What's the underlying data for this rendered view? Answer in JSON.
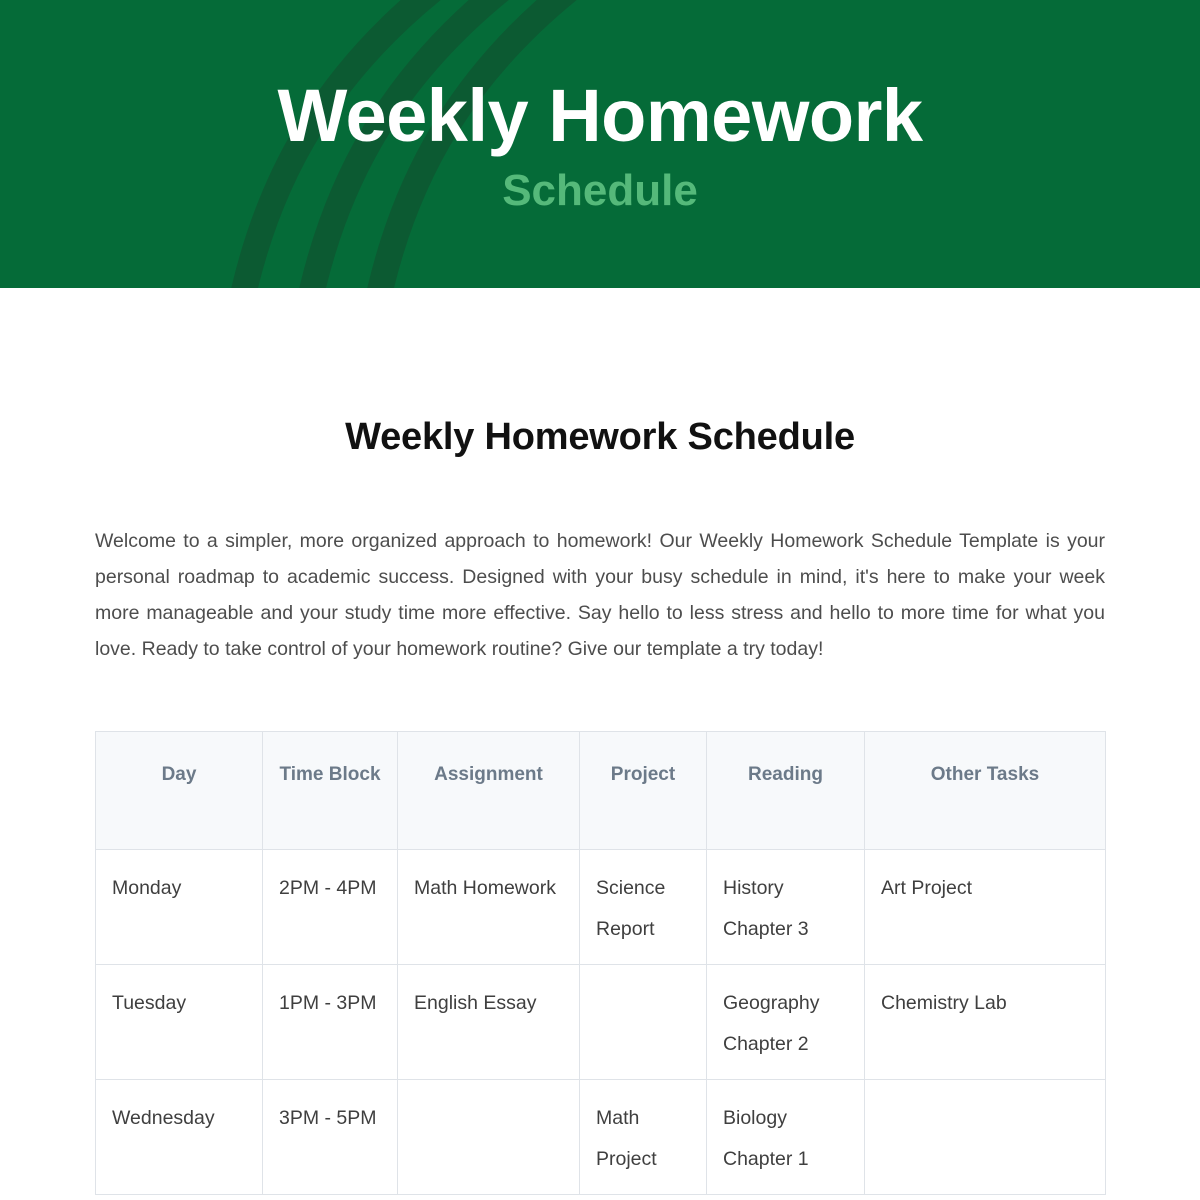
{
  "banner": {
    "title": "Weekly Homework",
    "subtitle": "Schedule",
    "background_color": "#056B38",
    "arc_color": "#0C5A32",
    "title_color": "#FFFFFF",
    "subtitle_color": "#55B97A"
  },
  "document": {
    "title": "Weekly Homework Schedule",
    "intro": "Welcome to a simpler, more organized approach to homework! Our Weekly Homework Schedule Template is your personal roadmap to academic success. Designed with your busy schedule in mind, it's here to make your week more manageable and your study time more effective. Say hello to less stress and hello to more time for what you love. Ready to take control of your homework routine? Give our template a try today!"
  },
  "table": {
    "header_background": "#F7F9FB",
    "header_text_color": "#6C7A89",
    "border_color": "#DFE3E8",
    "columns": [
      {
        "key": "day",
        "label": "Day"
      },
      {
        "key": "time_block",
        "label": "Time Block"
      },
      {
        "key": "assignment",
        "label": "Assignment"
      },
      {
        "key": "project",
        "label": "Project"
      },
      {
        "key": "reading",
        "label": "Reading"
      },
      {
        "key": "other_tasks",
        "label": "Other Tasks"
      }
    ],
    "rows": [
      {
        "day": "Monday",
        "time_block": "2PM - 4PM",
        "assignment": "Math Homework",
        "project": "Science Report",
        "reading": "History Chapter 3",
        "other_tasks": "Art Project"
      },
      {
        "day": "Tuesday",
        "time_block": "1PM - 3PM",
        "assignment": "English Essay",
        "project": "",
        "reading": "Geography Chapter 2",
        "other_tasks": "Chemistry Lab"
      },
      {
        "day": "Wednesday",
        "time_block": "3PM - 5PM",
        "assignment": "",
        "project": "Math Project",
        "reading": "Biology Chapter 1",
        "other_tasks": ""
      }
    ]
  }
}
